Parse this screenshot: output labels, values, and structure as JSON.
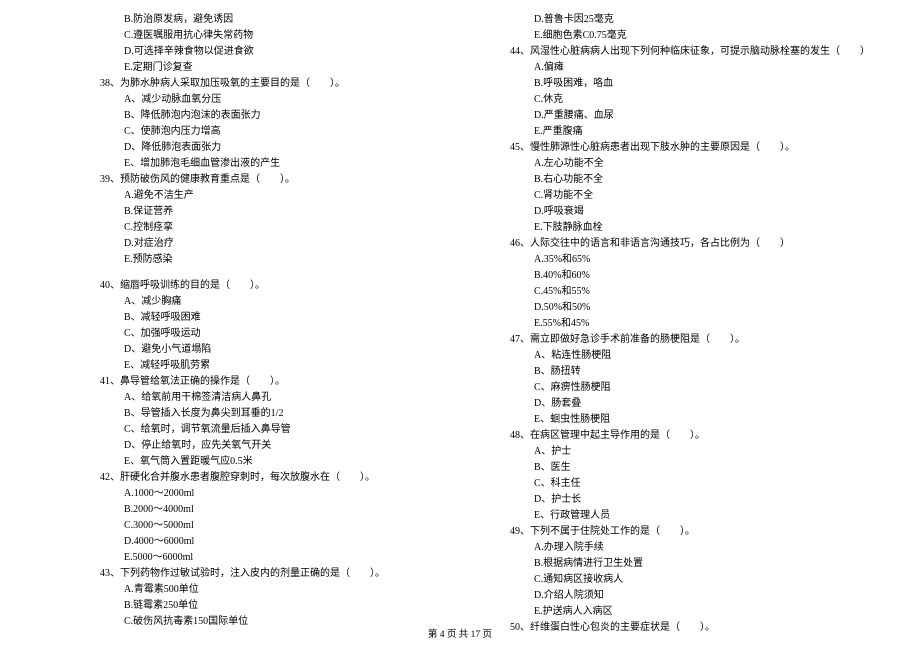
{
  "left_column": [
    {
      "type": "option",
      "text": "B.防治原发病，避免诱因"
    },
    {
      "type": "option",
      "text": "C.遵医嘱服用抗心律失常药物"
    },
    {
      "type": "option",
      "text": "D.可选择辛辣食物以促进食欲"
    },
    {
      "type": "option",
      "text": "E.定期门诊复查"
    },
    {
      "type": "question",
      "text": "38、为肺水肿病人采取加压吸氧的主要目的是（　　）。"
    },
    {
      "type": "option",
      "text": "A、减少动脉血氧分压"
    },
    {
      "type": "option",
      "text": "B、降低肺泡内泡沫的表面张力"
    },
    {
      "type": "option",
      "text": "C、使肺泡内压力增高"
    },
    {
      "type": "option",
      "text": "D、降低肺泡表面张力"
    },
    {
      "type": "option",
      "text": "E、增加肺泡毛细血管渗出液的产生"
    },
    {
      "type": "question",
      "text": "39、预防破伤风的健康教育重点是（　　）。"
    },
    {
      "type": "option",
      "text": "A.避免不洁生产"
    },
    {
      "type": "option",
      "text": "B.保证营养"
    },
    {
      "type": "option",
      "text": "C.控制痉挛"
    },
    {
      "type": "option",
      "text": "D.对症治疗"
    },
    {
      "type": "option",
      "text": "E.预防感染"
    },
    {
      "type": "spacer"
    },
    {
      "type": "question",
      "text": "40、缩唇呼吸训练的目的是（　　）。"
    },
    {
      "type": "option",
      "text": "A、减少胸痛"
    },
    {
      "type": "option",
      "text": "B、减轻呼吸困难"
    },
    {
      "type": "option",
      "text": "C、加强呼吸运动"
    },
    {
      "type": "option",
      "text": "D、避免小气道塌陷"
    },
    {
      "type": "option",
      "text": "E、减轻呼吸肌劳累"
    },
    {
      "type": "question",
      "text": "41、鼻导管给氧法正确的操作是（　　）。"
    },
    {
      "type": "option",
      "text": "A、给氧前用干棉签清洁病人鼻孔"
    },
    {
      "type": "option",
      "text": "B、导管插入长度为鼻尖到耳垂的1/2"
    },
    {
      "type": "option",
      "text": "C、给氧时，调节氧流量后插入鼻导管"
    },
    {
      "type": "option",
      "text": "D、停止给氧时，应先关氧气开关"
    },
    {
      "type": "option",
      "text": "E、氧气筒入置距暖气应0.5米"
    },
    {
      "type": "question",
      "text": "42、肝硬化合并腹水患者腹腔穿刺时，每次放腹水在（　　）。"
    },
    {
      "type": "option",
      "text": "A.1000～2000ml"
    },
    {
      "type": "option",
      "text": "B.2000～4000ml"
    },
    {
      "type": "option",
      "text": "C.3000～5000ml"
    },
    {
      "type": "option",
      "text": "D.4000～6000ml"
    },
    {
      "type": "option",
      "text": "E.5000～6000ml"
    },
    {
      "type": "question",
      "text": "43、下列药物作过敏试验时，注入皮内的剂量正确的是（　　）。"
    },
    {
      "type": "option",
      "text": "A.青霉素500单位"
    },
    {
      "type": "option",
      "text": "B.链霉素250单位"
    },
    {
      "type": "option",
      "text": "C.破伤风抗毒素150国际单位"
    }
  ],
  "right_column": [
    {
      "type": "option",
      "text": "D.普鲁卡因25毫克"
    },
    {
      "type": "option",
      "text": "E.细胞色素C0.75毫克"
    },
    {
      "type": "question",
      "text": "44、风湿性心脏病病人出现下列何种临床征象，可提示脑动脉栓塞的发生（　　）"
    },
    {
      "type": "option",
      "text": "A.偏瘫"
    },
    {
      "type": "option",
      "text": "B.呼吸困难，咯血"
    },
    {
      "type": "option",
      "text": "C.休克"
    },
    {
      "type": "option",
      "text": "D.严重腰痛、血尿"
    },
    {
      "type": "option",
      "text": "E.严重腹痛"
    },
    {
      "type": "question",
      "text": "45、慢性肺源性心脏病患者出现下肢水肿的主要原因是（　　）。"
    },
    {
      "type": "option",
      "text": "A.左心功能不全"
    },
    {
      "type": "option",
      "text": "B.右心功能不全"
    },
    {
      "type": "option",
      "text": "C.肾功能不全"
    },
    {
      "type": "option",
      "text": "D.呼吸衰竭"
    },
    {
      "type": "option",
      "text": "E.下肢静脉血栓"
    },
    {
      "type": "question",
      "text": "46、人际交往中的语言和非语言沟通技巧，各占比例为（　　）"
    },
    {
      "type": "option",
      "text": "A.35%和65%"
    },
    {
      "type": "option",
      "text": "B.40%和60%"
    },
    {
      "type": "option",
      "text": "C.45%和55%"
    },
    {
      "type": "option",
      "text": "D.50%和50%"
    },
    {
      "type": "option",
      "text": "E.55%和45%"
    },
    {
      "type": "question",
      "text": "47、需立即做好急诊手术前准备的肠梗阻是（　　）。"
    },
    {
      "type": "option",
      "text": "A、粘连性肠梗阻"
    },
    {
      "type": "option",
      "text": "B、肠扭转"
    },
    {
      "type": "option",
      "text": "C、麻痹性肠梗阻"
    },
    {
      "type": "option",
      "text": "D、肠套叠"
    },
    {
      "type": "option",
      "text": "E、蛔虫性肠梗阻"
    },
    {
      "type": "question",
      "text": "48、在病区管理中起主导作用的是（　　）。"
    },
    {
      "type": "option",
      "text": "A、护士"
    },
    {
      "type": "option",
      "text": "B、医生"
    },
    {
      "type": "option",
      "text": "C、科主任"
    },
    {
      "type": "option",
      "text": "D、护士长"
    },
    {
      "type": "option",
      "text": "E、行政管理人员"
    },
    {
      "type": "question",
      "text": "49、下列不属于住院处工作的是（　　）。"
    },
    {
      "type": "option",
      "text": "A.办理入院手续"
    },
    {
      "type": "option",
      "text": "B.根据病情进行卫生处置"
    },
    {
      "type": "option",
      "text": "C.通知病区接收病人"
    },
    {
      "type": "option",
      "text": "D.介绍人院须知"
    },
    {
      "type": "option",
      "text": "E.护送病人入病区"
    },
    {
      "type": "question",
      "text": "50、纤维蛋白性心包炎的主要症状是（　　）。"
    }
  ],
  "footer": "第 4 页 共 17 页"
}
